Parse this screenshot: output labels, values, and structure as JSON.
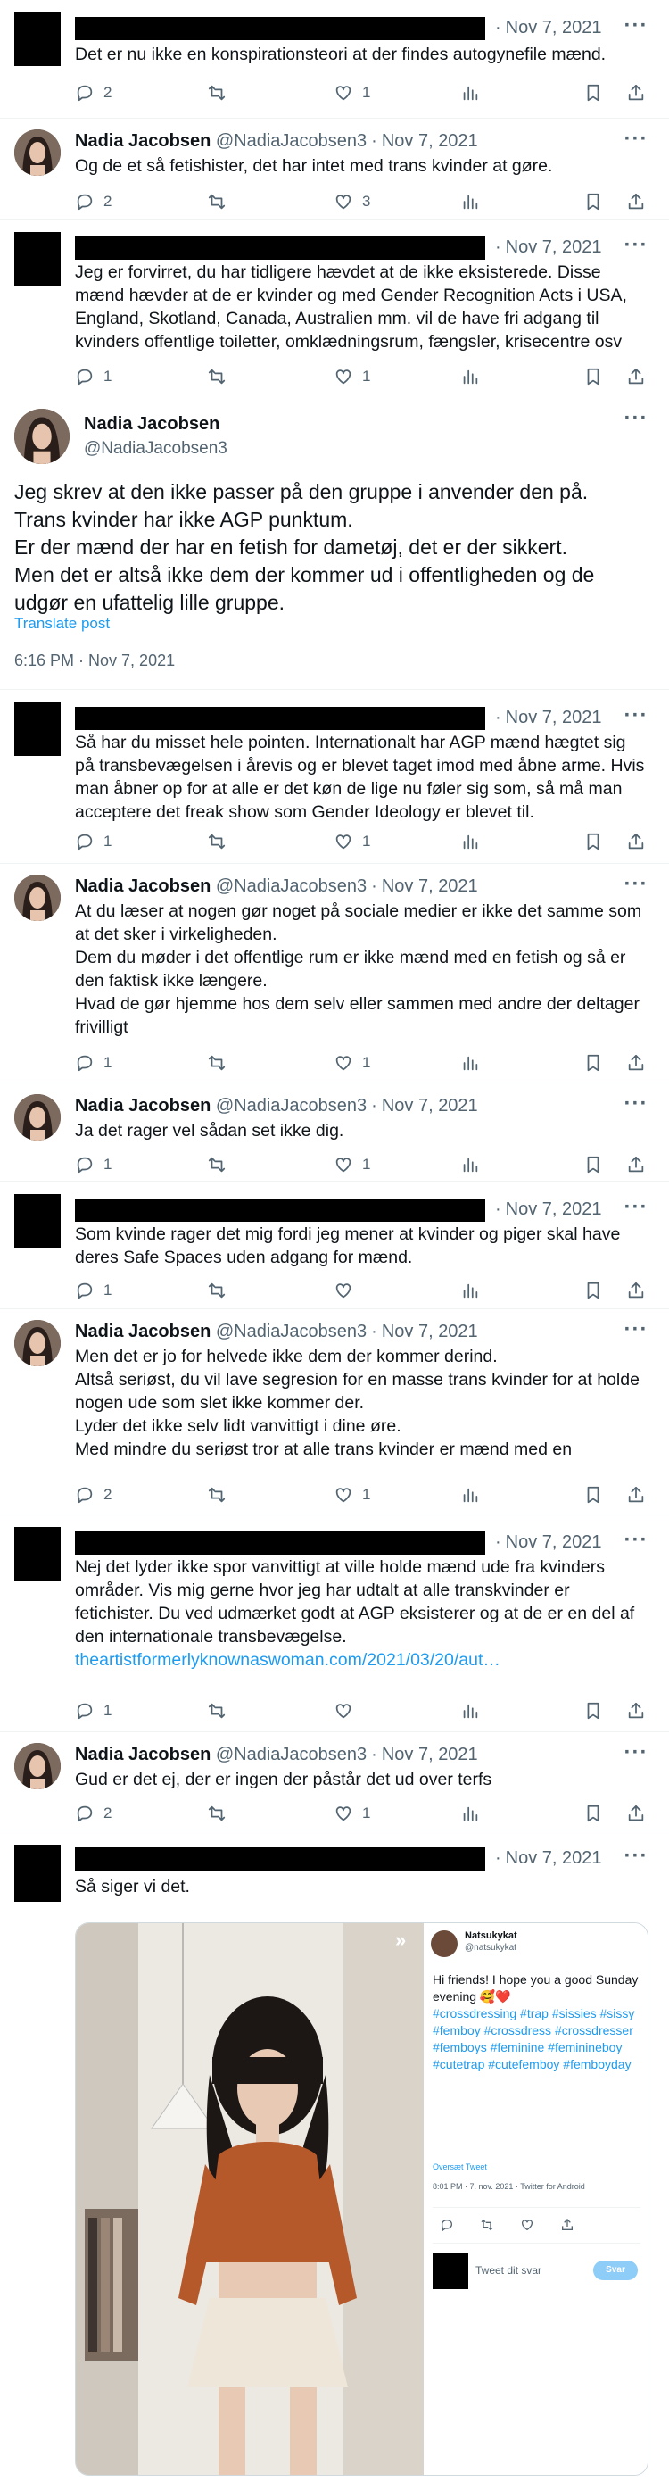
{
  "nadia": {
    "name": "Nadia Jacobsen",
    "handle": "@NadiaJacobsen3"
  },
  "sep": "·",
  "tweets": [
    {
      "date": "Nov 7, 2021",
      "lines": [
        "Det er nu ikke en konspirationsteori at der findes autogynefile mænd."
      ],
      "reply": "2",
      "retweet": "",
      "like": "1",
      "views": ""
    },
    {
      "date": "Nov 7, 2021",
      "lines": [
        "Og de et så fetishister, det har intet med trans kvinder at gøre."
      ],
      "reply": "2",
      "retweet": "",
      "like": "3",
      "views": ""
    },
    {
      "date": "Nov 7, 2021",
      "lines": [
        "Jeg er forvirret, du har tidligere hævdet at de ikke eksisterede. Disse mænd hævder at de er kvinder og med Gender Recognition Acts i USA, England, Skotland, Canada, Australien mm. vil de have fri adgang til kvinders offentlige toiletter, omklædningsrum, fængsler, krisecentre osv"
      ],
      "reply": "1",
      "retweet": "",
      "like": "1",
      "views": ""
    },
    {
      "date": "Nov 7, 2021",
      "lines": [
        "Så har du misset hele pointen. Internationalt har AGP mænd hægtet sig på transbevægelsen i årevis og er blevet taget imod med åbne arme. Hvis man åbner op for at alle er det køn de lige nu føler sig som, så må man acceptere det freak show som Gender Ideology er blevet til."
      ],
      "reply": "1",
      "retweet": "",
      "like": "1",
      "views": ""
    },
    {
      "date": "Nov 7, 2021",
      "lines": [
        "At du læser at nogen gør noget på sociale medier er ikke det samme som at det sker i virkeligheden.",
        "Dem du møder i det offentlige rum er ikke mænd med en fetish og så er den faktisk ikke længere.",
        "Hvad de gør hjemme hos dem selv eller sammen med andre der deltager frivilligt"
      ],
      "reply": "1",
      "retweet": "",
      "like": "1",
      "views": ""
    },
    {
      "date": "Nov 7, 2021",
      "lines": [
        "Ja det rager vel sådan set ikke dig."
      ],
      "reply": "1",
      "retweet": "",
      "like": "1",
      "views": ""
    },
    {
      "date": "Nov 7, 2021",
      "lines": [
        "Som kvinde rager det mig fordi jeg mener at kvinder og piger skal have deres Safe Spaces uden adgang for mænd."
      ],
      "reply": "1",
      "retweet": "",
      "like": "",
      "views": ""
    },
    {
      "date": "Nov 7, 2021",
      "lines": [
        "Men det er jo for helvede ikke dem der kommer derind.",
        "Altså seriøst, du vil lave segresion for en masse trans kvinder for at holde nogen ude som slet ikke kommer der.",
        "Lyder det ikke selv lidt vanvittigt i dine øre.",
        "Med mindre du seriøst tror at alle trans kvinder er mænd med en"
      ],
      "reply": "2",
      "retweet": "",
      "like": "1",
      "views": ""
    },
    {
      "date": "Nov 7, 2021",
      "lines": [
        "Nej det lyder ikke spor vanvittigt at ville holde mænd ude fra kvinders områder. Vis mig gerne hvor jeg har udtalt at alle transkvinder er fetichister. Du ved udmærket godt at AGP eksisterer og at de er en del af den internationale transbevægelse."
      ],
      "link": "theartistformerlyknownaswoman.com/2021/03/20/aut…",
      "reply": "1",
      "retweet": "",
      "like": "",
      "views": ""
    },
    {
      "date": "Nov 7, 2021",
      "lines": [
        "Gud er det ej, der er ingen der påstår det ud over terfs"
      ],
      "reply": "2",
      "retweet": "",
      "like": "1",
      "views": ""
    },
    {
      "date": "Nov 7, 2021",
      "lines": [
        "Så siger vi det."
      ]
    }
  ],
  "focus": {
    "lines": [
      "Jeg skrev at den ikke passer på den gruppe i anvender den på.",
      "Trans kvinder har ikke AGP punktum.",
      "Er der mænd der har en fetish for dametøj, det er der sikkert.",
      "Men det er altså ikke dem der kommer ud i offentligheden og de udgør en ufattelig lille gruppe."
    ],
    "translate": "Translate post",
    "time": "6:16 PM · Nov 7, 2021"
  },
  "embed": {
    "name": "Natsukykat",
    "handle": "@natsukykat",
    "text": "Hi friends! I hope you a good Sunday evening 🥰❤️",
    "tags": "#crossdressing #trap #sissies #sissy #femboy #crossdress #crossdresser #femboys #feminine #feminineboy #cutetrap #cutefemboy #femboyday",
    "translate": "Oversæt Tweet",
    "time": "8:01 PM · 7. nov. 2021 · Twitter for Android",
    "reply_placeholder": "Tweet dit svar",
    "reply_button": "Svar"
  },
  "icons": [
    "reply-icon",
    "retweet-icon",
    "like-icon",
    "views-icon",
    "bookmark-icon",
    "share-icon",
    "more-icon"
  ]
}
